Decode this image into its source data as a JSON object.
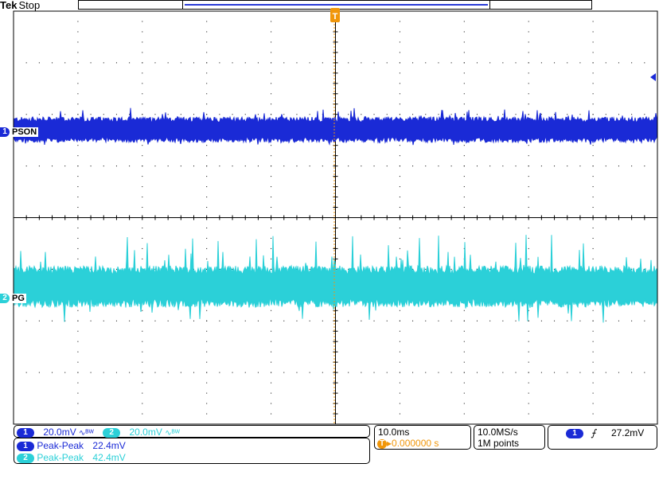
{
  "header": {
    "brand": "Tek",
    "status": "Stop"
  },
  "channels": [
    {
      "num": "1",
      "label": "PSON",
      "color": "#1a2ad6"
    },
    {
      "num": "2",
      "label": "PG",
      "color": "#2bd0d8"
    }
  ],
  "vertical": {
    "ch1": {
      "num": "1",
      "scale": "20.0mV"
    },
    "ch2": {
      "num": "2",
      "scale": "20.0mV"
    }
  },
  "measurements": [
    {
      "num": "1",
      "name": "Peak-Peak",
      "value": "22.4mV"
    },
    {
      "num": "2",
      "name": "Peak-Peak",
      "value": "42.4mV"
    }
  ],
  "timebase": {
    "scale": "10.0ms",
    "trigger_pos_icon": "T",
    "position": "▸0.000000 s"
  },
  "acquisition": {
    "rate": "10.0MS/s",
    "record": "1M points"
  },
  "trigger": {
    "source": "1",
    "slope_icon": "rising-edge-icon",
    "level": "27.2mV"
  },
  "trigger_marker": {
    "label": "T"
  },
  "colors": {
    "ch1": "#1a2ad6",
    "ch2": "#2bd0d8",
    "trigger": "#f0960a",
    "grid": "#000000"
  }
}
